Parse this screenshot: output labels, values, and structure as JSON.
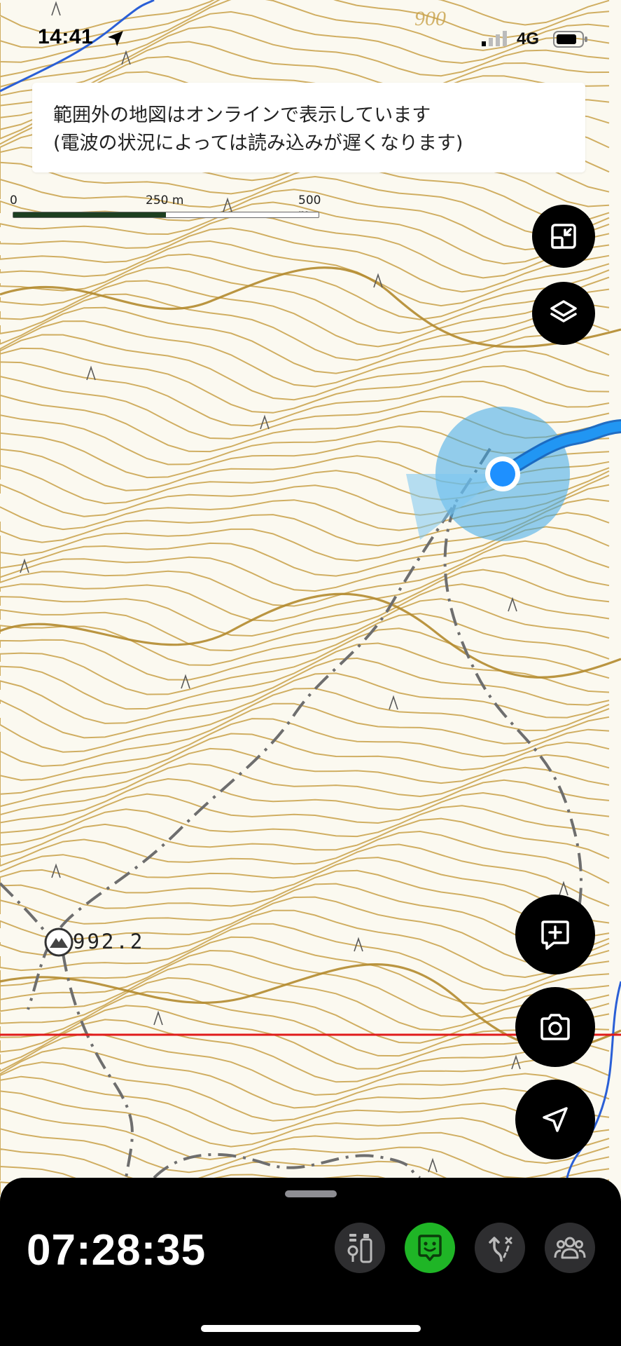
{
  "status_bar": {
    "time": "14:41",
    "network": "4G"
  },
  "notice": {
    "line1": "範囲外の地図はオンラインで表示しています",
    "line2": "(電波の状況によっては読み込みが遅くなります)"
  },
  "map": {
    "contour_label": "900",
    "summit_label": "992.2",
    "contour_color": "#c9a24a",
    "track_color": "#1e88e5",
    "reference_line_color": "#e01b1b"
  },
  "scale_bar": {
    "labels": [
      "0",
      "250 m",
      "500 m"
    ],
    "filled_fraction": 0.5
  },
  "map_controls": {
    "fit_icon": "fit-screen-icon",
    "layers_icon": "layers-icon",
    "add_memo_icon": "add-memo-icon",
    "camera_icon": "camera-icon",
    "locate_icon": "navigation-arrow-icon"
  },
  "bottom_panel": {
    "timer": "07:28:35",
    "buttons": [
      {
        "icon": "gear-checklist-icon",
        "active": false
      },
      {
        "icon": "face-status-icon",
        "active": true,
        "accent": "#1fb526"
      },
      {
        "icon": "route-off-icon",
        "active": false
      },
      {
        "icon": "group-icon",
        "active": false
      }
    ]
  }
}
